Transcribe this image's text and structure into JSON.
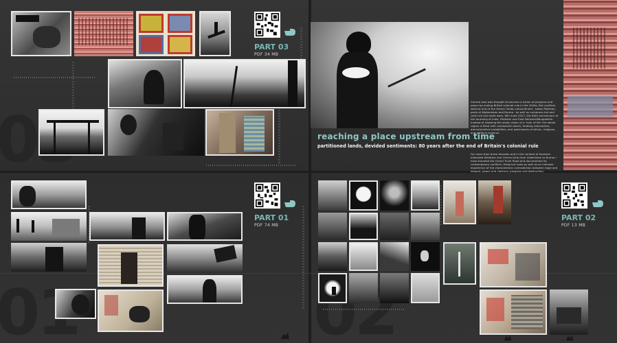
{
  "spread": {
    "part03": {
      "label": "PART 03",
      "size": "PDF 34 MB",
      "big_number": "03"
    },
    "part01": {
      "label": "PART 01",
      "size": "PDF 74 MB",
      "big_number": "01"
    },
    "part02": {
      "label": "PART 02",
      "size": "PDF 13 MB",
      "big_number": "02"
    },
    "feature": {
      "title": "reaching a place upstream from time",
      "subtitle": "partitioned lands, devided sentiments: 80 years after the end of Britain's colonial rule",
      "paragraph_1": "Central Asia was thought to become a haven of progress and peace by ending British colonial rule in the 1940s. But conflicts without end at the former Indian subcontinent - today Pakistan, parts of Afghanistan and Burma - as well as numerous hot and cold civil and state wars. Will mark 2027, the 80th anniversary of the founding of India, Pakistan and East Pakistan/Bangladesh. Instead of realizing the shaky vision of a 'river of life' the whole region is filled with unresolved claims, floating nationalism, administrative instabilities, and patchworks of ethnic, religious, and political violence.",
      "paragraph_2": "For more than three decades and in the context of fourteen extended fieldtrips into Central Asia from Uzbekistan to Burma I have traveled the Grand Trunk Road and documented its contemporary conflicts. Historical roots as well as an intimate experience of the characteristic contradiction between hope and despair, peace and violence, progress and destruction."
    },
    "colors": {
      "accent": "#79b7b4",
      "title": "#8fc7c5",
      "background": "#2f2f2f",
      "redline": "#7a2a24"
    }
  }
}
